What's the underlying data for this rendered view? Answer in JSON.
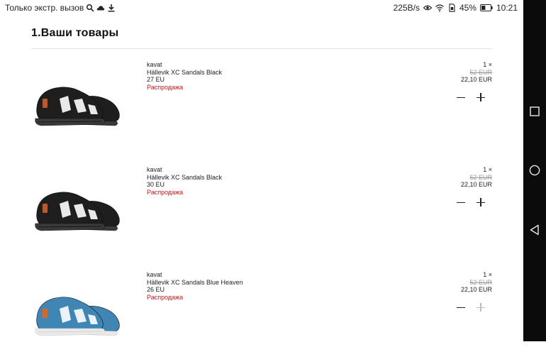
{
  "status_bar": {
    "carrier_text": "Только экстр. вызов",
    "icons": [
      "search-icon",
      "cloud-icon",
      "download-icon"
    ],
    "net_speed": "225B/s",
    "status_icons": [
      "eye-icon",
      "wifi-icon",
      "sim-icon"
    ],
    "battery_percent": "45%",
    "battery_level": 0.45,
    "time": "10:21"
  },
  "section": {
    "title": "1.Ваши товары"
  },
  "cart_items": [
    {
      "brand": "kavat",
      "name": "Hällevik XC Sandals Black",
      "size": "27 EU",
      "badge": "Распродажа",
      "quantity": "1 ×",
      "old_price": "52 EUR",
      "price": "22,10 EUR",
      "color": "#1e1e1e",
      "plus_enabled": true
    },
    {
      "brand": "kavat",
      "name": "Hällevik XC Sandals Black",
      "size": "30 EU",
      "badge": "Распродажа",
      "quantity": "1 ×",
      "old_price": "52 EUR",
      "price": "22,10 EUR",
      "color": "#1e1e1e",
      "plus_enabled": true
    },
    {
      "brand": "kavat",
      "name": "Hällevik XC Sandals Blue Heaven",
      "size": "26 EU",
      "badge": "Распродажа",
      "quantity": "1 ×",
      "old_price": "52 EUR",
      "price": "22,10 EUR",
      "color": "#3f86b4",
      "plus_enabled": false
    }
  ],
  "nav_bar": {
    "buttons": [
      "recents-square-icon",
      "home-circle-icon",
      "back-triangle-icon"
    ]
  },
  "colors": {
    "sale_red": "#d0171c",
    "nav_background": "#0b0b0b",
    "divider": "#e6e6e6"
  }
}
